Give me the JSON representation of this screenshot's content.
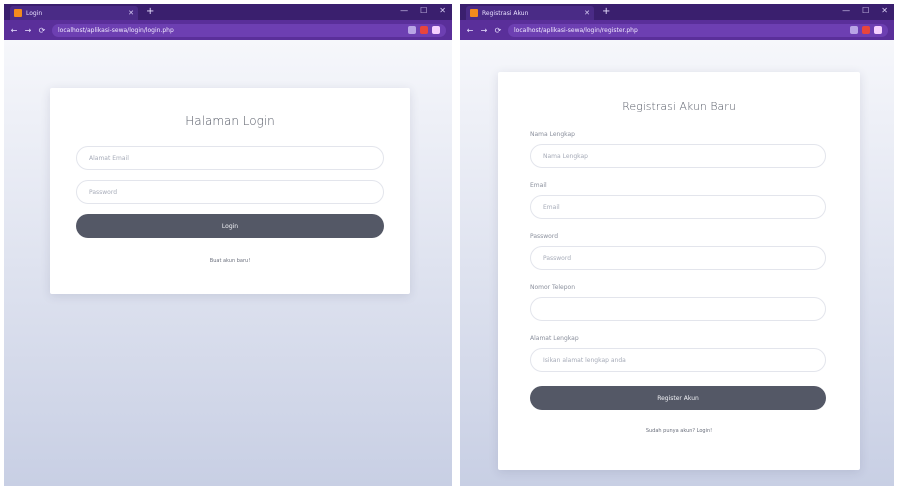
{
  "left_window": {
    "tab_title": "Login",
    "url": "localhost/aplikasi-sewa/login/login.php",
    "card": {
      "title": "Halaman Login",
      "email_placeholder": "Alamat Email",
      "password_placeholder": "Password",
      "submit_label": "Login",
      "register_link": "Buat akun baru!"
    }
  },
  "right_window": {
    "tab_title": "Registrasi Akun",
    "url": "localhost/aplikasi-sewa/login/register.php",
    "card": {
      "title": "Registrasi Akun Baru",
      "name_label": "Nama Lengkap",
      "name_placeholder": "Nama Lengkap",
      "email_label": "Email",
      "email_placeholder": "Email",
      "password_label": "Password",
      "password_placeholder": "Password",
      "phone_label": "Nomor Telepon",
      "phone_value": "",
      "address_label": "Alamat Lengkap",
      "address_placeholder": "Isikan alamat lengkap anda",
      "submit_label": "Register Akun",
      "login_link": "Sudah punya akun? Login!"
    }
  },
  "browser": {
    "new_tab": "+",
    "back": "←",
    "forward": "→",
    "reload": "⟳",
    "minimize": "—",
    "maximize": "☐",
    "close": "✕",
    "tab_close": "✕"
  },
  "colors": {
    "titlebar": "#3a1f6e",
    "navbar": "#5a2f9a",
    "button": "#545866",
    "favicon": "#f28b1c"
  }
}
